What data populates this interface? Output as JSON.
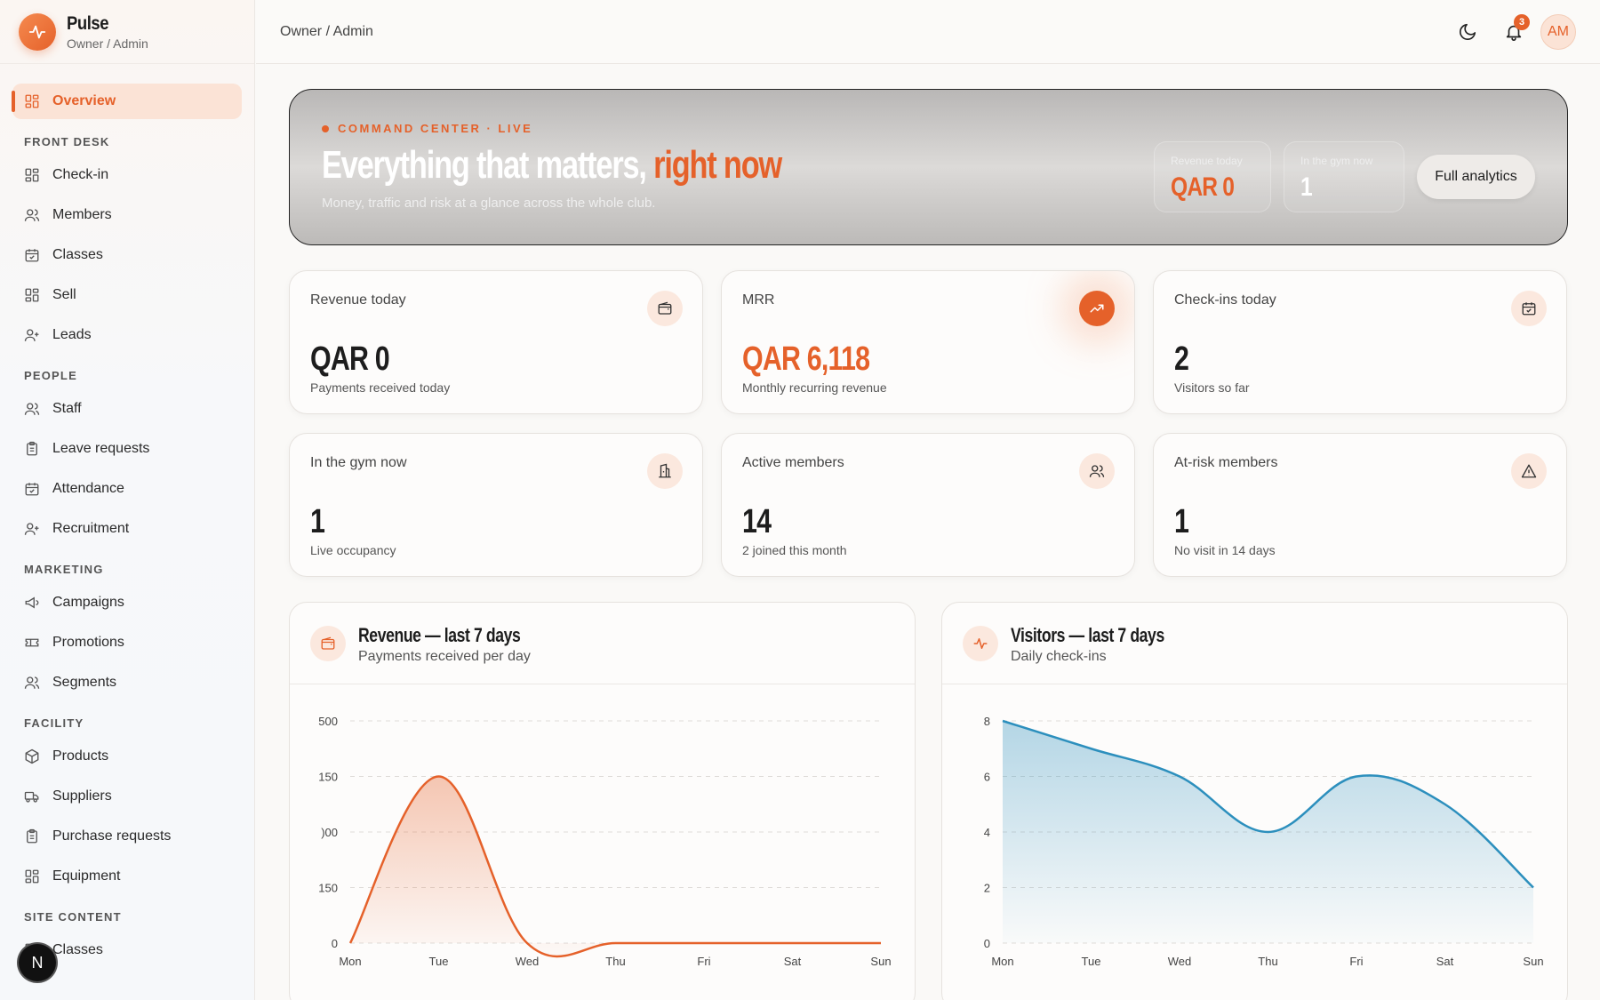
{
  "brand": {
    "name": "Pulse",
    "role": "Owner / Admin"
  },
  "topbar": {
    "breadcrumb": "Owner / Admin",
    "notification_count": "3",
    "avatar_initials": "AM"
  },
  "sidebar": {
    "overview": "Overview",
    "sections": [
      {
        "title": "FRONT DESK",
        "items": [
          "Check-in",
          "Members",
          "Classes",
          "Sell",
          "Leads"
        ]
      },
      {
        "title": "PEOPLE",
        "items": [
          "Staff",
          "Leave requests",
          "Attendance",
          "Recruitment"
        ]
      },
      {
        "title": "MARKETING",
        "items": [
          "Campaigns",
          "Promotions",
          "Segments"
        ]
      },
      {
        "title": "FACILITY",
        "items": [
          "Products",
          "Suppliers",
          "Purchase requests",
          "Equipment"
        ]
      },
      {
        "title": "SITE CONTENT",
        "items": [
          "Classes"
        ]
      }
    ],
    "dev_badge": "N"
  },
  "hero": {
    "kicker": "COMMAND CENTER · LIVE",
    "title_main": "Everything that matters, ",
    "title_accent": "right now",
    "subtitle": "Money, traffic and risk at a glance across the whole club.",
    "stat1_label": "Revenue today",
    "stat1_value": "QAR 0",
    "stat2_label": "In the gym now",
    "stat2_value": "1",
    "button": "Full analytics"
  },
  "kpis": [
    {
      "label": "Revenue today",
      "value": "QAR 0",
      "sub": "Payments received today",
      "icon": "wallet-icon"
    },
    {
      "label": "MRR",
      "value": "QAR 6,118",
      "sub": "Monthly recurring revenue",
      "icon": "trending-up-icon"
    },
    {
      "label": "Check-ins today",
      "value": "2",
      "sub": "Visitors so far",
      "icon": "calendar-check-icon"
    },
    {
      "label": "In the gym now",
      "value": "1",
      "sub": "Live occupancy",
      "icon": "building-icon"
    },
    {
      "label": "Active members",
      "value": "14",
      "sub": "2 joined this month",
      "icon": "users-icon"
    },
    {
      "label": "At-risk members",
      "value": "1",
      "sub": "No visit in 14 days",
      "icon": "alert-triangle-icon"
    }
  ],
  "colors": {
    "accent": "#e5612a",
    "visitors_line": "#2c8fbd"
  },
  "revenue_panel": {
    "title": "Revenue — last 7 days",
    "subtitle": "Payments received per day"
  },
  "visitors_panel": {
    "title": "Visitors — last 7 days",
    "subtitle": "Daily check-ins"
  },
  "chart_data": [
    {
      "type": "area",
      "categories": [
        "Mon",
        "Tue",
        "Wed",
        "Thu",
        "Fri",
        "Sat",
        "Sun"
      ],
      "series": [
        {
          "values": [
            0,
            150,
            0,
            0,
            0,
            0,
            0
          ]
        }
      ],
      "ylim": [
        0,
        200
      ],
      "yticks": [
        "0",
        "150",
        ")00",
        "150",
        "500"
      ],
      "grid": true
    },
    {
      "type": "area",
      "categories": [
        "Mon",
        "Tue",
        "Wed",
        "Thu",
        "Fri",
        "Sat",
        "Sun"
      ],
      "series": [
        {
          "values": [
            8,
            7,
            6,
            4,
            6,
            5,
            2
          ]
        }
      ],
      "ylim": [
        0,
        8
      ],
      "yticks": [
        "0",
        "2",
        "4",
        "6",
        "8"
      ],
      "grid": true
    }
  ]
}
